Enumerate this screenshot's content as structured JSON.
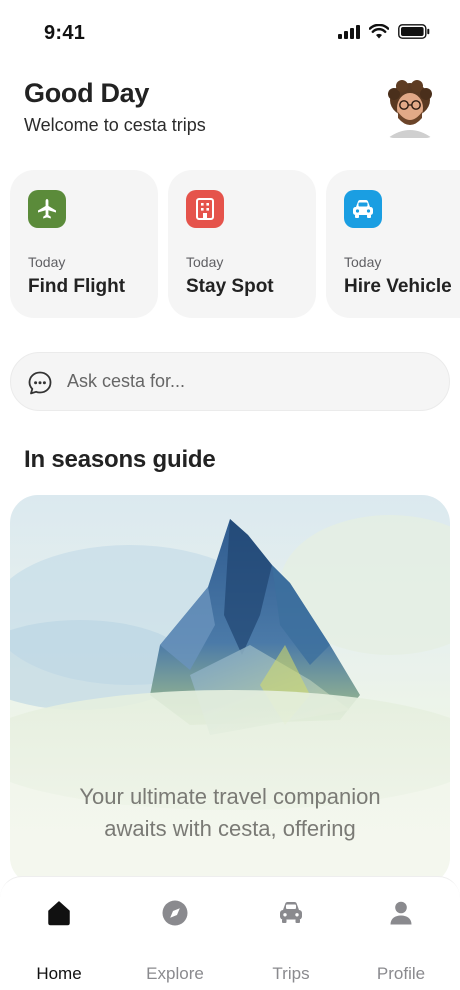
{
  "status": {
    "time": "9:41"
  },
  "header": {
    "greeting": "Good Day",
    "subtitle": "Welcome to cesta trips"
  },
  "services": [
    {
      "when": "Today",
      "name": "Find Flight",
      "icon": "airplane-icon",
      "color": "#5b8b3a"
    },
    {
      "when": "Today",
      "name": "Stay Spot",
      "icon": "hotel-icon",
      "color": "#e5534b"
    },
    {
      "when": "Today",
      "name": "Hire Vehicle",
      "icon": "car-icon",
      "color": "#1a9ee2"
    }
  ],
  "search": {
    "placeholder": "Ask cesta for..."
  },
  "guide": {
    "section_title": "In seasons guide",
    "text_line1": "Your ultimate travel companion",
    "text_line2": "awaits with cesta, offering"
  },
  "tabs": [
    {
      "label": "Home",
      "icon": "home-icon",
      "active": true
    },
    {
      "label": "Explore",
      "icon": "compass-icon",
      "active": false
    },
    {
      "label": "Trips",
      "icon": "car-icon",
      "active": false
    },
    {
      "label": "Profile",
      "icon": "person-icon",
      "active": false
    }
  ]
}
